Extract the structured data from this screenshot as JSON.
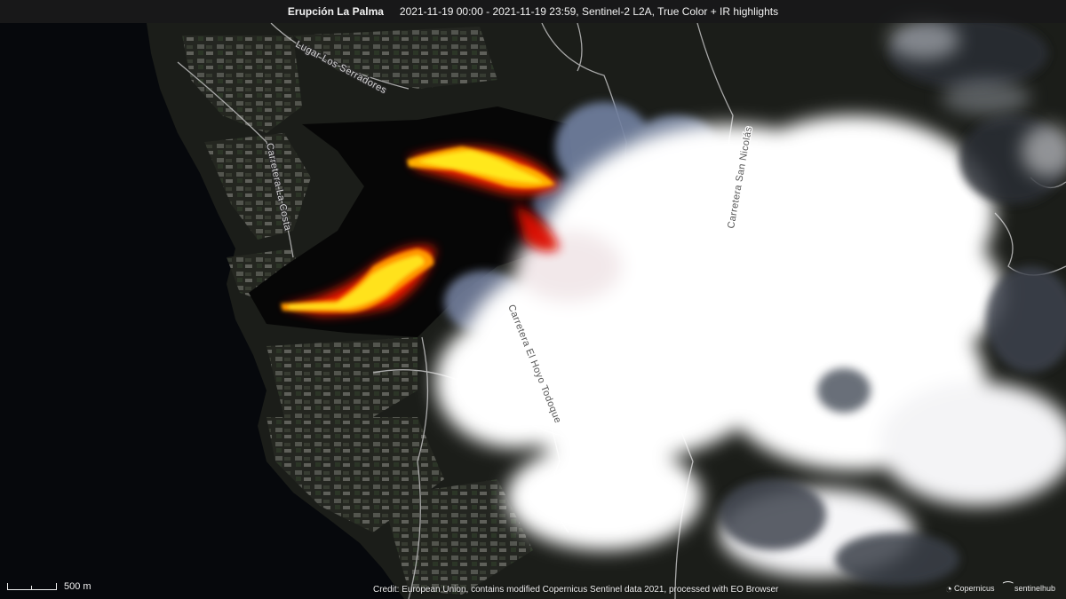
{
  "header": {
    "title": "Erupción La Palma",
    "details": "2021-11-19 00:00 - 2021-11-19 23:59, Sentinel-2 L2A, True Color + IR highlights"
  },
  "map": {
    "road_labels": {
      "lugar_los_serradores": "Lugar Los Serradores",
      "carretera_la_costa": "Carretera La Costa",
      "carretera_san_nicolas": "Carretera San Nicolás",
      "carretera_el_hoyo_todoque": "Carretera El Hoyo Todoque"
    },
    "colors": {
      "ocean": "#06080c",
      "land_dark": "#1c1e1a",
      "lava_core": "#ffe020",
      "lava_edge": "#ff2800",
      "cloud": "#ffffff",
      "smoke": "#6d7a96",
      "road": "#bdbdbd"
    }
  },
  "scale": {
    "label": "500 m"
  },
  "footer": {
    "credit": "Credit: European Union, contains modified Copernicus Sentinel data 2021, processed with EO Browser",
    "logo_copernicus": "Copernicus",
    "logo_sentinelhub": "sentinelhub",
    "copernicus_icon": "copernicus-c-icon",
    "sentinelhub_icon": "sentinelhub-s-icon"
  }
}
